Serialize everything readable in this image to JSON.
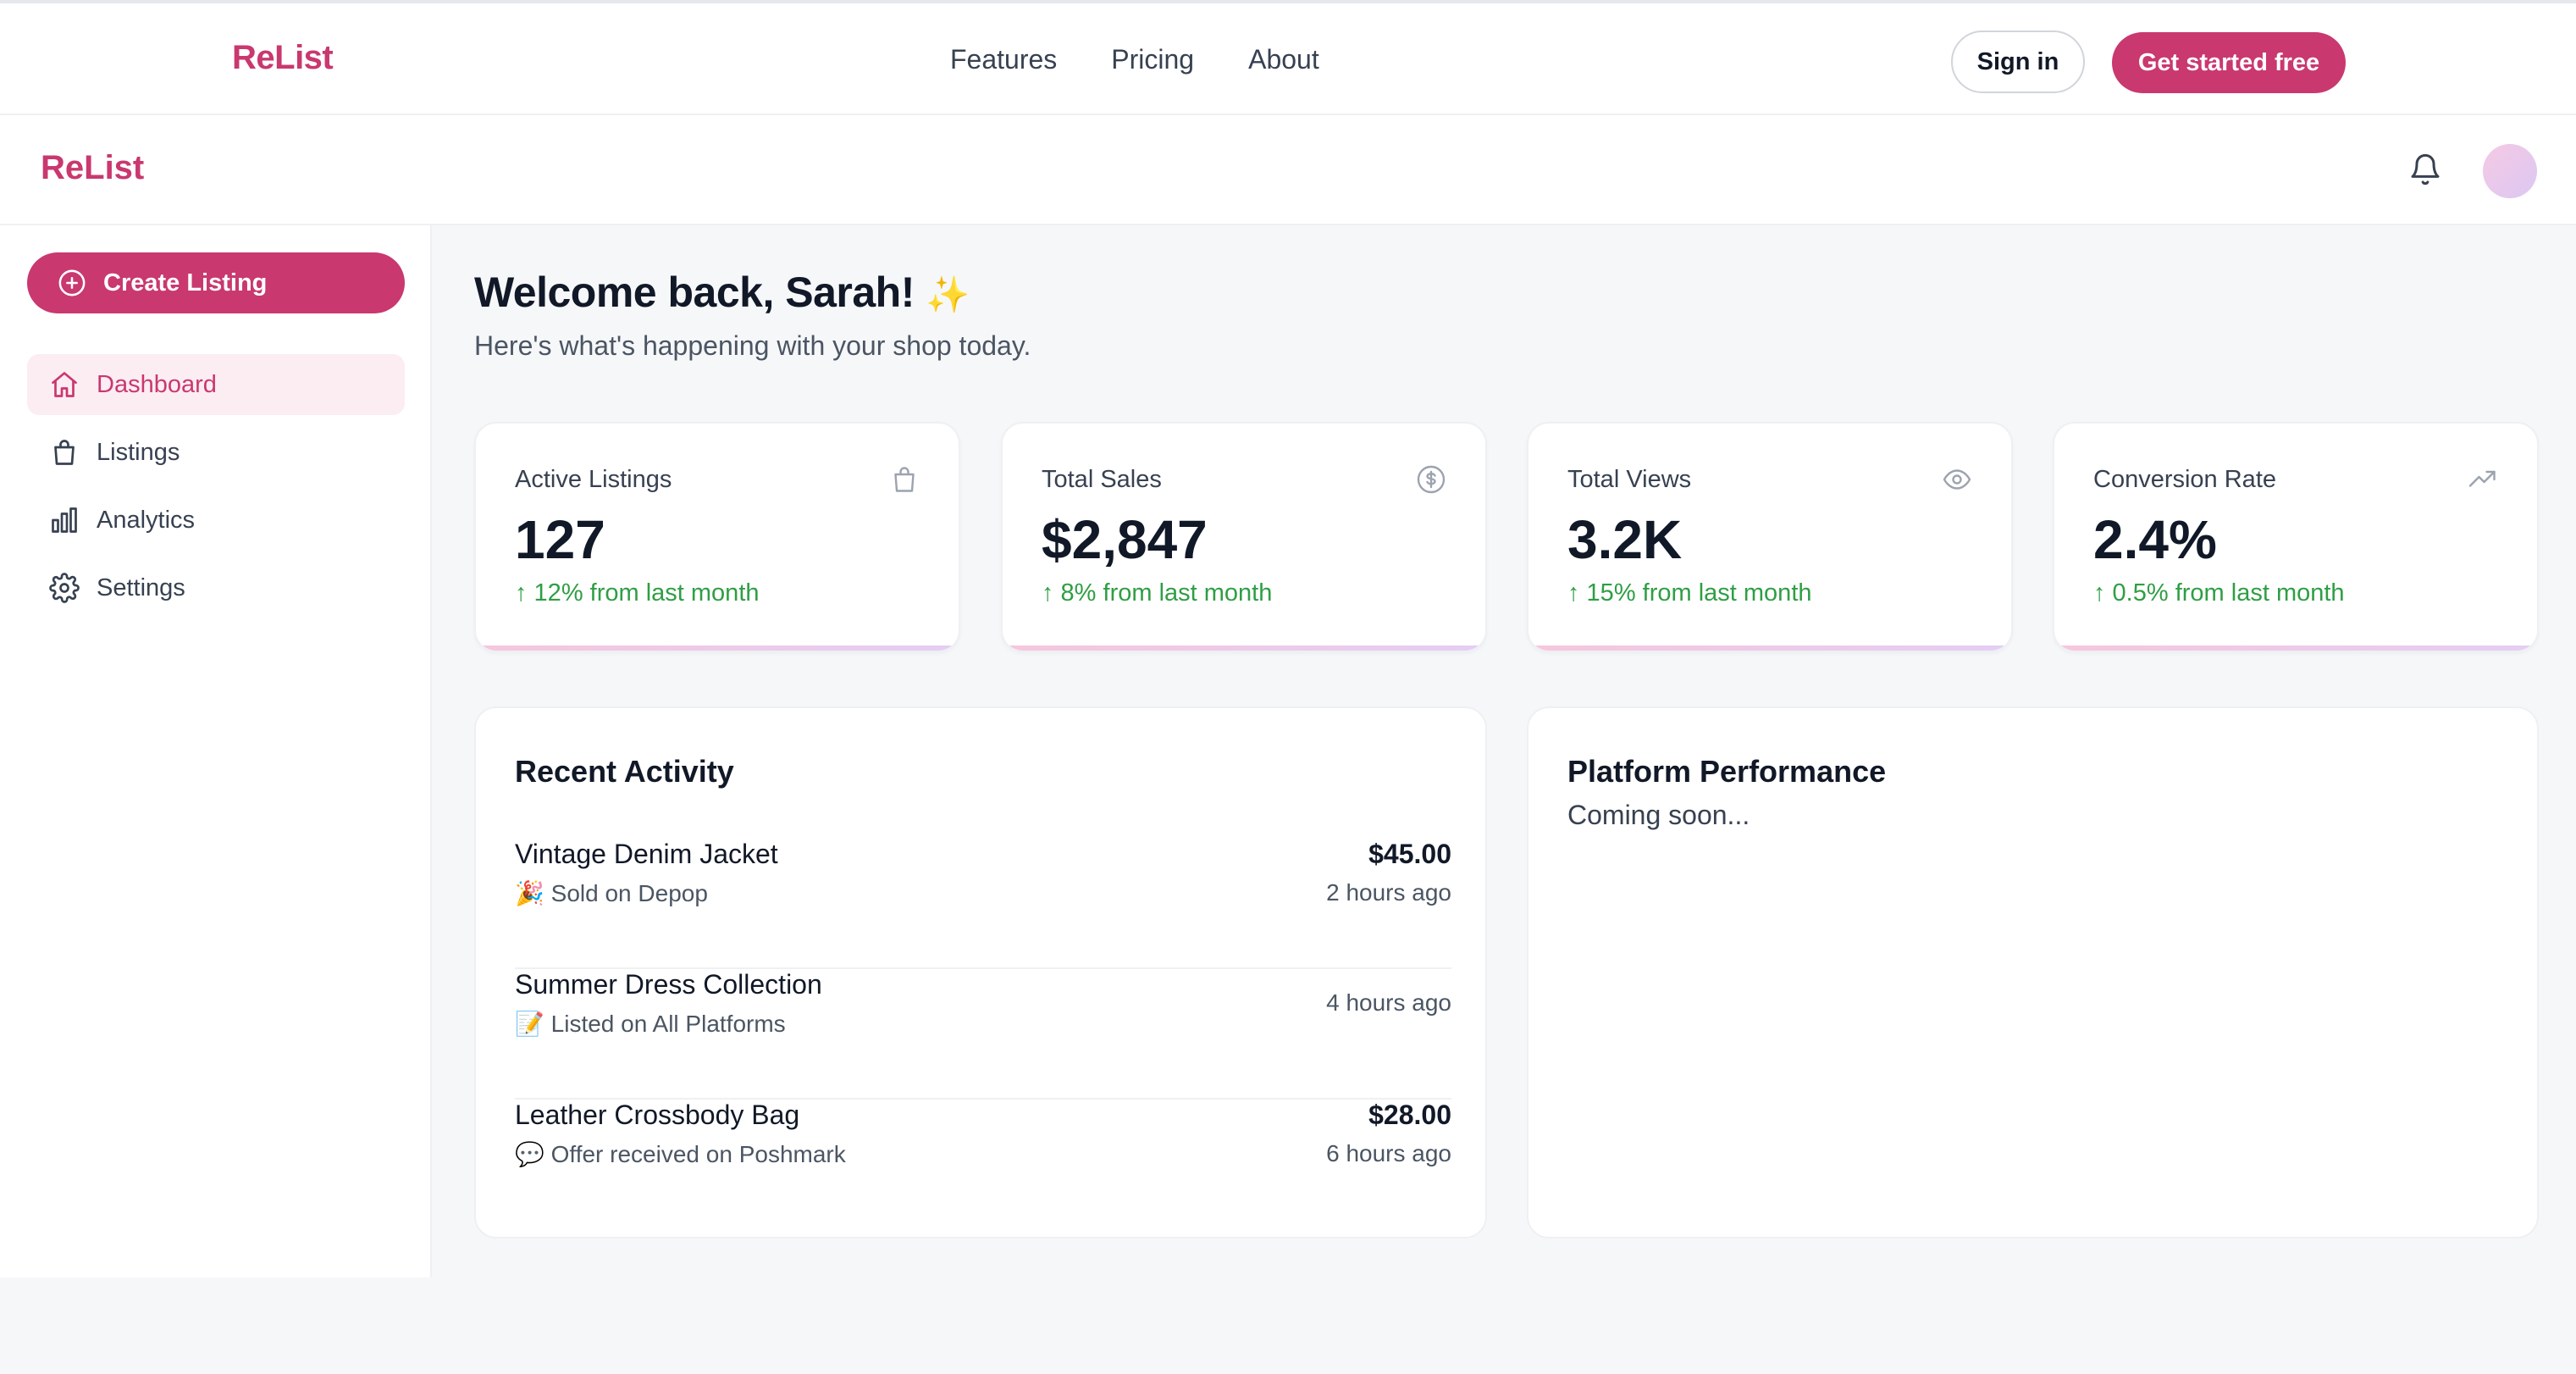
{
  "topnav": {
    "brand": "ReList",
    "links": [
      "Features",
      "Pricing",
      "About"
    ],
    "sign_in": "Sign in",
    "cta": "Get started free"
  },
  "app_header": {
    "brand": "ReList"
  },
  "sidebar": {
    "create_label": "Create Listing",
    "items": [
      {
        "label": "Dashboard",
        "icon": "home-icon",
        "active": true
      },
      {
        "label": "Listings",
        "icon": "shopping-bag-icon"
      },
      {
        "label": "Analytics",
        "icon": "bar-chart-icon"
      },
      {
        "label": "Settings",
        "icon": "gear-icon"
      }
    ]
  },
  "main": {
    "welcome": "Welcome back, Sarah!",
    "welcome_emoji": "✨",
    "subtitle": "Here's what's happening with your shop today.",
    "stats": [
      {
        "label": "Active Listings",
        "value": "127",
        "delta": "↑ 12% from last month",
        "icon": "shopping-bag-icon"
      },
      {
        "label": "Total Sales",
        "value": "$2,847",
        "delta": "↑ 8% from last month",
        "icon": "dollar-circle-icon"
      },
      {
        "label": "Total Views",
        "value": "3.2K",
        "delta": "↑ 15% from last month",
        "icon": "eye-icon"
      },
      {
        "label": "Conversion Rate",
        "value": "2.4%",
        "delta": "↑ 0.5% from last month",
        "icon": "trending-up-icon"
      }
    ],
    "activity": {
      "title": "Recent Activity",
      "rows": [
        {
          "name": "Vintage Denim Jacket",
          "emoji": "🎉",
          "detail": "Sold on Depop",
          "price": "$45.00",
          "time": "2 hours ago"
        },
        {
          "name": "Summer Dress Collection",
          "emoji": "📝",
          "detail": "Listed on All Platforms",
          "price": "",
          "time": "4 hours ago"
        },
        {
          "name": "Leather Crossbody Bag",
          "emoji": "💬",
          "detail": "Offer received on Poshmark",
          "price": "$28.00",
          "time": "6 hours ago"
        }
      ]
    },
    "platform": {
      "title": "Platform Performance",
      "status": "Coming soon..."
    }
  },
  "colors": {
    "brand": "#c9386f",
    "positive": "#2f9e44",
    "active_bg": "#fcedf3"
  }
}
